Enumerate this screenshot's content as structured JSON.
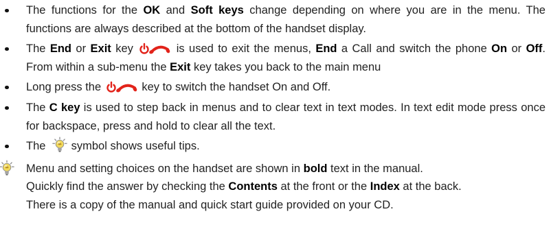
{
  "bullets": [
    {
      "lines": [
        {
          "runs": [
            {
              "text": "The functions for the "
            },
            {
              "text": "OK",
              "bold": true
            },
            {
              "text": " and "
            },
            {
              "text": "Soft keys",
              "bold": true
            },
            {
              "text": " change depending on where you are in the menu. The"
            }
          ]
        },
        {
          "runs": [
            {
              "text": "functions are always described at the bottom of the handset display."
            }
          ]
        }
      ]
    },
    {
      "lines": [
        {
          "runs": [
            {
              "text": "The "
            },
            {
              "text": "End",
              "bold": true
            },
            {
              "text": " or "
            },
            {
              "text": "Exit",
              "bold": true
            },
            {
              "text": " key "
            },
            {
              "icon": "end-call-key-icon"
            },
            {
              "text": " is used to exit the menus, "
            },
            {
              "text": "End",
              "bold": true
            },
            {
              "text": " a Call and switch the phone "
            },
            {
              "text": "On",
              "bold": true
            },
            {
              "text": " or "
            },
            {
              "text": "Off",
              "bold": true
            },
            {
              "text": "."
            }
          ]
        },
        {
          "runs": [
            {
              "text": "From within a sub-menu the "
            },
            {
              "text": "Exit",
              "bold": true
            },
            {
              "text": " key takes you back to the main menu"
            }
          ]
        }
      ]
    },
    {
      "lines": [
        {
          "runs": [
            {
              "text": "Long press the "
            },
            {
              "icon": "end-call-key-icon"
            },
            {
              "text": " key to switch the handset On and Off."
            }
          ]
        }
      ]
    },
    {
      "lines": [
        {
          "runs": [
            {
              "text": "The "
            },
            {
              "text": "C key",
              "bold": true
            },
            {
              "text": " is used to step back in menus and to clear text in text modes. In text edit mode press once"
            }
          ]
        },
        {
          "runs": [
            {
              "text": "for backspace, press and hold to clear all the text."
            }
          ]
        }
      ]
    },
    {
      "lines": [
        {
          "runs": [
            {
              "text": "The "
            },
            {
              "icon": "tip-bulb-icon"
            },
            {
              "text": " symbol shows useful tips."
            }
          ]
        }
      ]
    }
  ],
  "tip": {
    "icon": "tip-bulb-icon",
    "lines": [
      {
        "runs": [
          {
            "text": "Menu and setting choices on the handset are shown in "
          },
          {
            "text": "bold",
            "bold": true
          },
          {
            "text": " text in the manual."
          }
        ]
      },
      {
        "runs": [
          {
            "text": "Quickly find the answer by checking the "
          },
          {
            "text": "Contents",
            "bold": true
          },
          {
            "text": " at the front or the "
          },
          {
            "text": "Index",
            "bold": true
          },
          {
            "text": " at the back."
          }
        ]
      },
      {
        "runs": [
          {
            "text": "There is a copy of the manual and quick start guide provided on your CD."
          }
        ]
      }
    ]
  },
  "colors": {
    "text": "#222222",
    "icon_red": "#e2231a"
  }
}
